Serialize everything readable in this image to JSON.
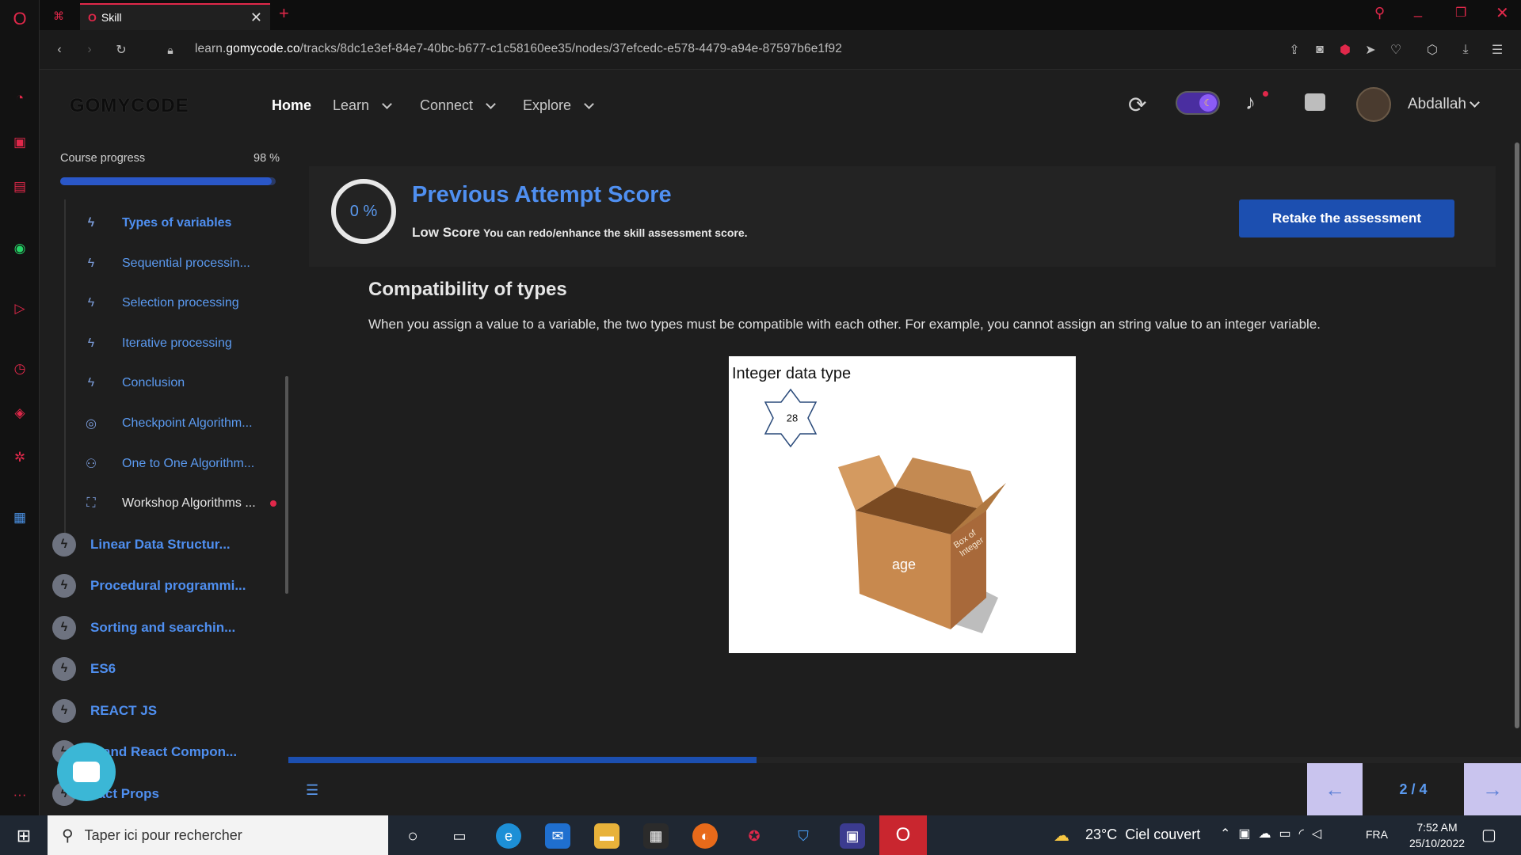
{
  "browser": {
    "tab_title": "Skill",
    "url_prefix": "learn.",
    "url_domain": "gomycode.co",
    "url_path": "/tracks/8dc1e3ef-84e7-40bc-b677-c1c58160ee35/nodes/37efcedc-e578-4479-a94e-87597b6e1f92",
    "new_tab": "+",
    "window_controls": [
      "search-icon",
      "minimize-icon",
      "restore-icon",
      "close-icon"
    ]
  },
  "header": {
    "logo": "GOMYCODE",
    "nav": [
      {
        "label": "Home",
        "active": true
      },
      {
        "label": "Learn",
        "dropdown": true
      },
      {
        "label": "Connect",
        "dropdown": true
      },
      {
        "label": "Explore",
        "dropdown": true
      }
    ],
    "user_name": "Abdallah"
  },
  "sidebar": {
    "progress_label": "Course progress",
    "progress_value": "98 %",
    "progress_fraction": 0.98,
    "items": [
      {
        "label": "Types of variables",
        "icon": "bolt-icon",
        "selected": true
      },
      {
        "label": "Sequential processin...",
        "icon": "bolt-icon"
      },
      {
        "label": "Selection processing",
        "icon": "bolt-icon"
      },
      {
        "label": "Iterative processing",
        "icon": "bolt-icon"
      },
      {
        "label": "Conclusion",
        "icon": "bolt-icon"
      },
      {
        "label": "Checkpoint Algorithm...",
        "icon": "target-icon"
      },
      {
        "label": "One to One Algorithm...",
        "icon": "people-icon"
      },
      {
        "label": "Workshop Algorithms ...",
        "icon": "workshop-icon",
        "dot": true
      }
    ],
    "chapters": [
      {
        "label": "Linear Data Structur..."
      },
      {
        "label": "Procedural programmi..."
      },
      {
        "label": "Sorting and searchin..."
      },
      {
        "label": "ES6"
      },
      {
        "label": "REACT JS"
      },
      {
        "label": "X and React Compon..."
      },
      {
        "label": "eact Props"
      }
    ]
  },
  "score": {
    "percent": "0 %",
    "title": "Previous Attempt Score",
    "status": "Low Score",
    "hint": "You can redo/enhance the skill assessment score.",
    "retake_label": "Retake the assessment"
  },
  "content": {
    "title": "Compatibility of types",
    "body": "When you assign a value to a variable, the two types must be compatible with each other. For example, you cannot assign an string value to an integer variable.",
    "figure": {
      "caption": "Integer data type",
      "star_value": "28",
      "box_front_label": "age",
      "box_side_label": "Box of Integer"
    }
  },
  "pager": {
    "text": "2 / 4",
    "slide_fraction": 0.38
  },
  "taskbar": {
    "search_placeholder": "Taper ici pour rechercher",
    "weather": "23°C  Ciel couvert",
    "lang": "FRA",
    "time": "7:52 AM",
    "date": "25/10/2022"
  }
}
